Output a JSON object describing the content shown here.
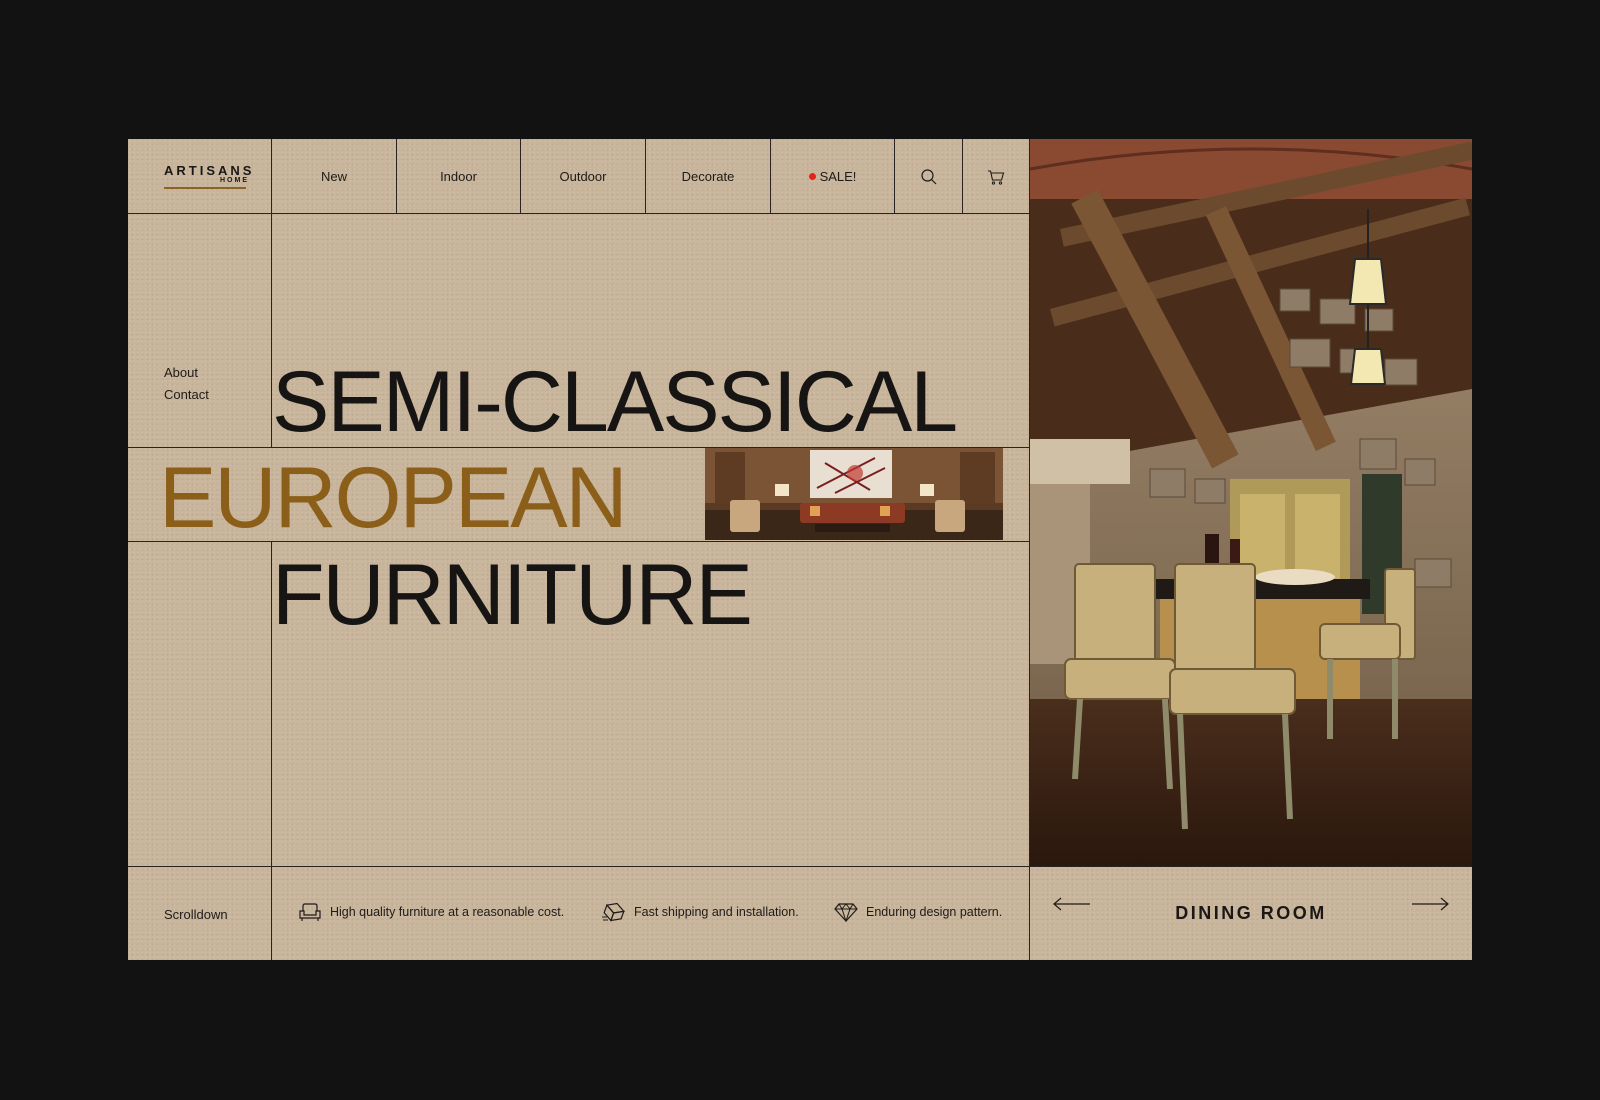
{
  "brand": {
    "name": "ARTISANS",
    "sub": "HOME"
  },
  "nav": {
    "items": [
      "New",
      "Indoor",
      "Outdoor",
      "Decorate"
    ],
    "sale_label": "SALE!"
  },
  "side": {
    "about": "About",
    "contact": "Contact"
  },
  "headline": {
    "line1": "SEMI-CLASSICAL",
    "line2": "EUROPEAN",
    "line3": "FURNITURE"
  },
  "footer": {
    "scrolldown": "Scrolldown",
    "features": [
      {
        "icon": "armchair-icon",
        "text": "High quality furniture at a reasonable cost."
      },
      {
        "icon": "shipping-box-icon",
        "text": "Fast shipping and installation."
      },
      {
        "icon": "diamond-icon",
        "text": "Enduring design pattern."
      }
    ]
  },
  "gallery": {
    "room_label": "DINING ROOM"
  },
  "colors": {
    "background": "#c8b59b",
    "accent": "#8b5e1a",
    "sale_dot": "#e0261b",
    "outer": "#121212"
  }
}
